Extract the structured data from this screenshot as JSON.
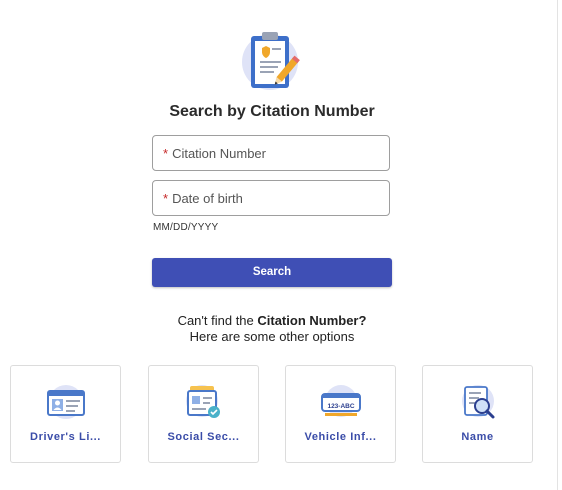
{
  "heading": "Search by Citation Number",
  "form": {
    "citation_placeholder": "Citation Number",
    "dob_placeholder": "Date of birth",
    "required_mark": "*",
    "dob_hint": "MM/DD/YYYY",
    "search_label": "Search"
  },
  "alternatives": {
    "line1_prefix": "Can't find the ",
    "line1_bold": "Citation Number?",
    "line2": "Here are some other options",
    "options": [
      {
        "label": "Driver's Li...",
        "icon": "id-card-icon"
      },
      {
        "label": "Social Sec...",
        "icon": "social-security-card-icon"
      },
      {
        "label": "Vehicle Inf...",
        "icon": "license-plate-icon"
      },
      {
        "label": "Name",
        "icon": "document-search-icon"
      }
    ]
  },
  "colors": {
    "primary": "#3f4fb5",
    "label_blue": "#3a4ca8",
    "required": "#c62828",
    "icon_bg": "#dfe3f7"
  }
}
